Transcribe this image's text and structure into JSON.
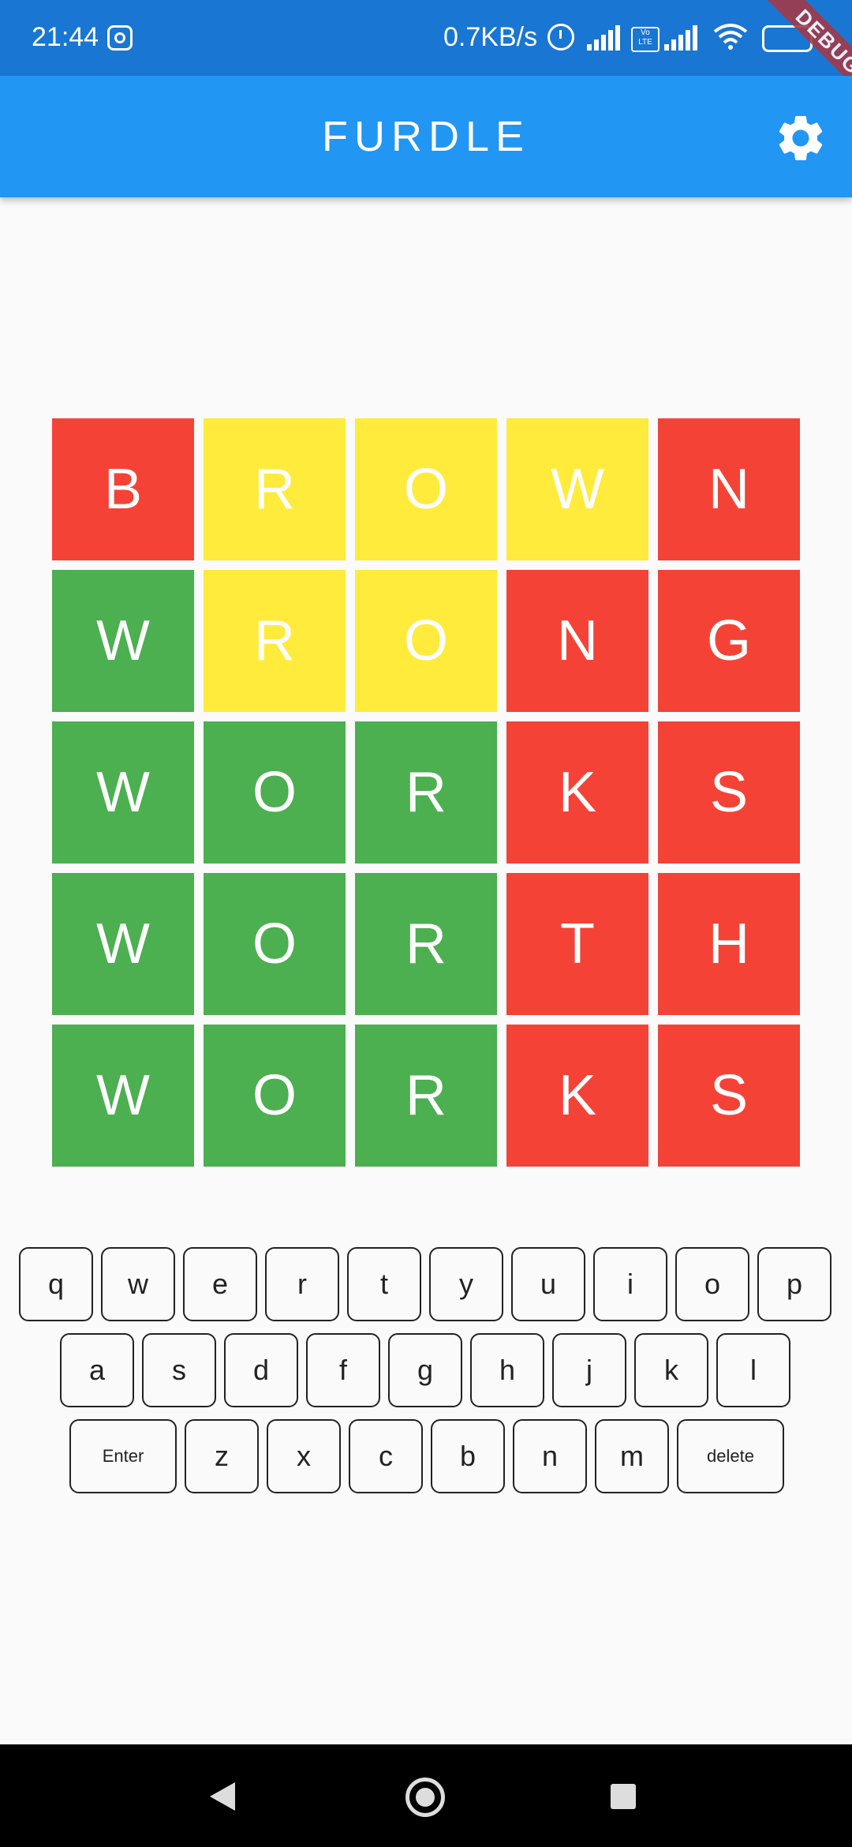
{
  "status_bar": {
    "time": "21:44",
    "speed": "0.7KB/s",
    "volte": "Vo LTE",
    "debug": "DEBUG",
    "icons": [
      "instagram-icon",
      "alarm-icon",
      "signal-icon",
      "volte-icon",
      "signal-icon",
      "wifi-icon",
      "battery-icon"
    ]
  },
  "app_bar": {
    "title": "FURDLE",
    "settings_icon": "gear-icon"
  },
  "colors": {
    "green": "#4caf50",
    "yellow": "#ffeb3b",
    "red": "#f44336",
    "app_bar": "#2196f3",
    "status_bar": "#1976d2"
  },
  "grid": [
    [
      {
        "l": "B",
        "c": "red"
      },
      {
        "l": "R",
        "c": "yellow"
      },
      {
        "l": "O",
        "c": "yellow"
      },
      {
        "l": "W",
        "c": "yellow"
      },
      {
        "l": "N",
        "c": "red"
      }
    ],
    [
      {
        "l": "W",
        "c": "green"
      },
      {
        "l": "R",
        "c": "yellow"
      },
      {
        "l": "O",
        "c": "yellow"
      },
      {
        "l": "N",
        "c": "red"
      },
      {
        "l": "G",
        "c": "red"
      }
    ],
    [
      {
        "l": "W",
        "c": "green"
      },
      {
        "l": "O",
        "c": "green"
      },
      {
        "l": "R",
        "c": "green"
      },
      {
        "l": "K",
        "c": "red"
      },
      {
        "l": "S",
        "c": "red"
      }
    ],
    [
      {
        "l": "W",
        "c": "green"
      },
      {
        "l": "O",
        "c": "green"
      },
      {
        "l": "R",
        "c": "green"
      },
      {
        "l": "T",
        "c": "red"
      },
      {
        "l": "H",
        "c": "red"
      }
    ],
    [
      {
        "l": "W",
        "c": "green"
      },
      {
        "l": "O",
        "c": "green"
      },
      {
        "l": "R",
        "c": "green"
      },
      {
        "l": "K",
        "c": "red"
      },
      {
        "l": "S",
        "c": "red"
      }
    ]
  ],
  "keyboard": {
    "row1": [
      "q",
      "w",
      "e",
      "r",
      "t",
      "y",
      "u",
      "i",
      "o",
      "p"
    ],
    "row2": [
      "a",
      "s",
      "d",
      "f",
      "g",
      "h",
      "j",
      "k",
      "l"
    ],
    "row3": [
      "Enter",
      "z",
      "x",
      "c",
      "b",
      "n",
      "m",
      "delete"
    ]
  },
  "nav": {
    "icons": [
      "back-icon",
      "home-icon",
      "recents-icon"
    ]
  }
}
